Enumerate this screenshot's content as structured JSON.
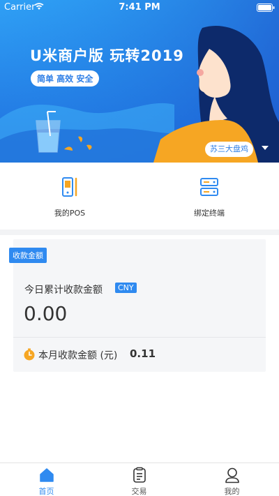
{
  "status_bar": {
    "carrier": "Carrier",
    "time": "7:41 PM"
  },
  "banner": {
    "title": "U米商户版  玩转2019",
    "slogan": "简单 高效 安全",
    "merchant_name": "苏三大盘鸡",
    "merchant_dropdown_icon": "caret-down-icon",
    "colors": {
      "gradient_top": "#2fa0f5",
      "gradient_bottom": "#1e5fd6",
      "accent_orange": "#f6a623"
    }
  },
  "actions": [
    {
      "label": "我的POS",
      "icon": "pos-device-icon"
    },
    {
      "label": "绑定终端",
      "icon": "server-terminal-icon"
    }
  ],
  "card": {
    "tag": "收款金额",
    "subtitle": "今日累计收款金额",
    "currency": "CNY",
    "today_amount": "0.00",
    "month_label": "本月收款金额 (元)",
    "month_amount": "0.11",
    "month_icon": "stopwatch-icon"
  },
  "tabbar": {
    "tabs": [
      {
        "label": "首页",
        "icon": "home-icon",
        "active": true
      },
      {
        "label": "交易",
        "icon": "clipboard-icon",
        "active": false
      },
      {
        "label": "我的",
        "icon": "user-icon",
        "active": false
      }
    ],
    "active_color": "#2f8af0"
  }
}
